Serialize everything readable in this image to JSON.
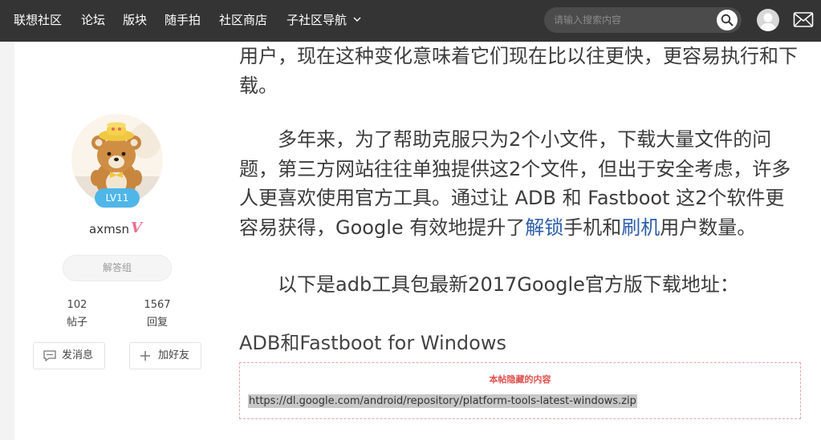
{
  "nav": {
    "items": [
      "联想社区",
      "论坛",
      "版块",
      "随手拍",
      "社区商店",
      "子社区导航"
    ],
    "search_placeholder": "请输入搜索内容"
  },
  "profile": {
    "level": "LV11",
    "username": "axmsn",
    "verified_mark": "V",
    "group": "解答组",
    "posts_count": "102",
    "posts_label": "帖子",
    "replies_count": "1567",
    "replies_label": "回复",
    "message_button": "发消息",
    "add_friend_button": "加好友"
  },
  "article": {
    "p1": "用户，现在这种变化意味着它们现在比以往更快，更容易执行和下载。",
    "p2_a": "　　多年来，为了帮助克服只为2个小文件，下载大量文件的问题，第三方网站往往单独提供这2个文件，但出于安全考虑，许多人更喜欢使用官方工具。通过让 ADB 和 Fastboot 这2个软件更容易获得，Google 有效地提升了",
    "p2_link1": "解锁",
    "p2_b": "手机和",
    "p2_link2": "刷机",
    "p2_c": "用户数量。",
    "p3": "　　以下是adb工具包最新2017Google官方版下载地址：",
    "heading": "ADB和Fastboot for Windows",
    "hidden_title": "本帖隐藏的内容",
    "hidden_url": "https://dl.google.com/android/repository/platform-tools-latest-windows.zip"
  },
  "colors": {
    "topbar": "#343434",
    "badge": "#4fb6e8",
    "link": "#2d5ea8",
    "hidden_border": "#e8a4a4",
    "hidden_title": "#e05050"
  }
}
